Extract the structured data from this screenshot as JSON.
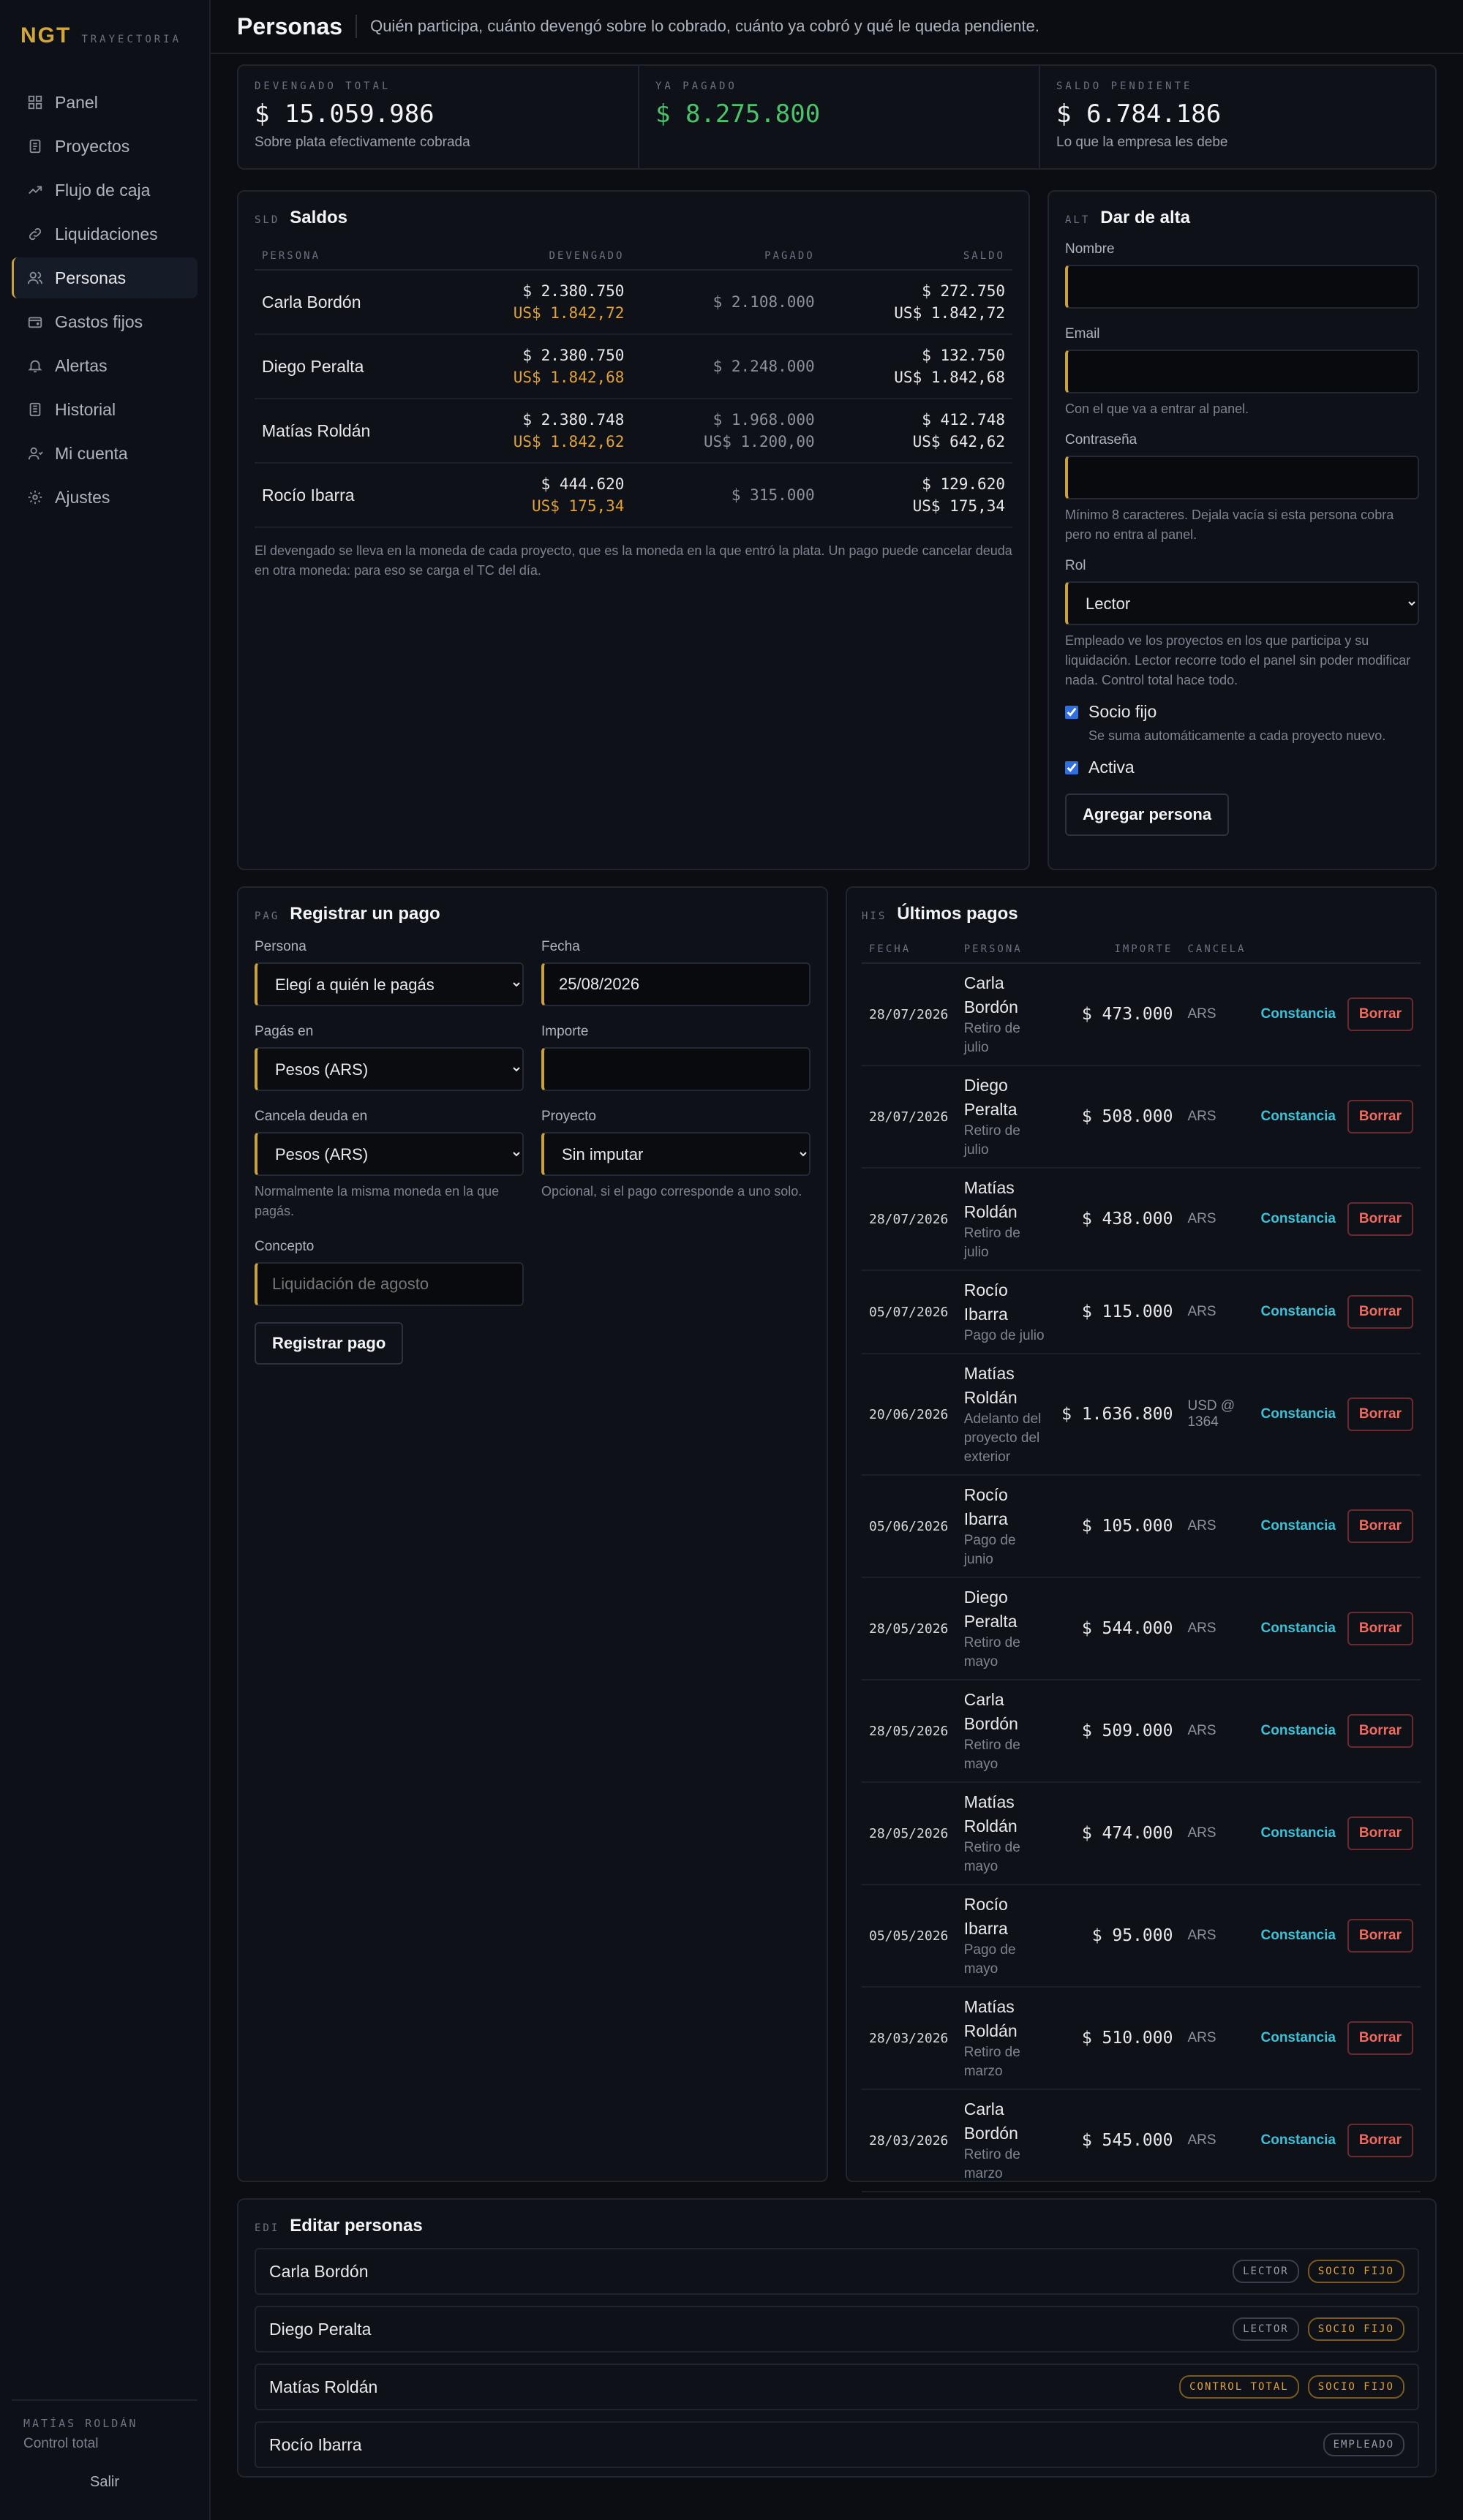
{
  "brand": {
    "logo": "NGT",
    "sub": "TRAYECTORIA"
  },
  "nav": [
    {
      "label": "Panel",
      "icon": "dashboard-icon"
    },
    {
      "label": "Proyectos",
      "icon": "document-icon"
    },
    {
      "label": "Flujo de caja",
      "icon": "trend-icon"
    },
    {
      "label": "Liquidaciones",
      "icon": "link-icon"
    },
    {
      "label": "Personas",
      "icon": "users-icon",
      "active": true
    },
    {
      "label": "Gastos fijos",
      "icon": "wallet-icon"
    },
    {
      "label": "Alertas",
      "icon": "bell-icon"
    },
    {
      "label": "Historial",
      "icon": "history-icon"
    },
    {
      "label": "Mi cuenta",
      "icon": "user-icon"
    },
    {
      "label": "Ajustes",
      "icon": "gear-icon"
    }
  ],
  "user": {
    "name": "MATÍAS ROLDÁN",
    "role": "Control total",
    "logout": "Salir"
  },
  "header": {
    "title": "Personas",
    "subtitle": "Quién participa, cuánto devengó sobre lo cobrado, cuánto ya cobró y qué le queda pendiente."
  },
  "stats": [
    {
      "label": "DEVENGADO TOTAL",
      "value": "$ 15.059.986",
      "note": "Sobre plata efectivamente cobrada"
    },
    {
      "label": "YA PAGADO",
      "value": "$ 8.275.800",
      "note": ""
    },
    {
      "label": "SALDO PENDIENTE",
      "value": "$ 6.784.186",
      "note": "Lo que la empresa les debe"
    }
  ],
  "saldos": {
    "code": "SLD",
    "title": "Saldos",
    "headers": [
      "PERSONA",
      "DEVENGADO",
      "PAGADO",
      "SALDO"
    ],
    "rows": [
      {
        "persona": "Carla Bordón",
        "dev_ars": "$ 2.380.750",
        "dev_usd": "US$ 1.842,72",
        "pag_ars": "$ 2.108.000",
        "pag_usd": "",
        "sal_ars": "$ 272.750",
        "sal_usd": "US$ 1.842,72"
      },
      {
        "persona": "Diego Peralta",
        "dev_ars": "$ 2.380.750",
        "dev_usd": "US$ 1.842,68",
        "pag_ars": "$ 2.248.000",
        "pag_usd": "",
        "sal_ars": "$ 132.750",
        "sal_usd": "US$ 1.842,68"
      },
      {
        "persona": "Matías Roldán",
        "dev_ars": "$ 2.380.748",
        "dev_usd": "US$ 1.842,62",
        "pag_ars": "$ 1.968.000",
        "pag_usd": "US$ 1.200,00",
        "sal_ars": "$ 412.748",
        "sal_usd": "US$ 642,62"
      },
      {
        "persona": "Rocío Ibarra",
        "dev_ars": "$ 444.620",
        "dev_usd": "US$ 175,34",
        "pag_ars": "$ 315.000",
        "pag_usd": "",
        "sal_ars": "$ 129.620",
        "sal_usd": "US$ 175,34"
      }
    ],
    "note": "El devengado se lleva en la moneda de cada proyecto, que es la moneda en la que entró la plata. Un pago puede cancelar deuda en otra moneda: para eso se carga el TC del día."
  },
  "alta": {
    "code": "ALT",
    "title": "Dar de alta",
    "nombre_label": "Nombre",
    "email_label": "Email",
    "email_help": "Con el que va a entrar al panel.",
    "pass_label": "Contraseña",
    "pass_help": "Mínimo 8 caracteres. Dejala vacía si esta persona cobra pero no entra al panel.",
    "rol_label": "Rol",
    "rol_value": "Lector",
    "rol_help": "Empleado ve los proyectos en los que participa y su liquidación. Lector recorre todo el panel sin poder modificar nada. Control total hace todo.",
    "socio_label": "Socio fijo",
    "socio_help": "Se suma automáticamente a cada proyecto nuevo.",
    "activa_label": "Activa",
    "submit": "Agregar persona"
  },
  "pago": {
    "code": "PAG",
    "title": "Registrar un pago",
    "persona_label": "Persona",
    "persona_value": "Elegí a quién le pagás",
    "fecha_label": "Fecha",
    "fecha_value": "25/08/2026",
    "pagas_label": "Pagás en",
    "pagas_value": "Pesos (ARS)",
    "importe_label": "Importe",
    "importe_value": "",
    "cancela_label": "Cancela deuda en",
    "cancela_value": "Pesos (ARS)",
    "cancela_help": "Normalmente la misma moneda en la que pagás.",
    "proyecto_label": "Proyecto",
    "proyecto_value": "Sin imputar",
    "proyecto_help": "Opcional, si el pago corresponde a uno solo.",
    "concepto_label": "Concepto",
    "concepto_placeholder": "Liquidación de agosto",
    "submit": "Registrar pago"
  },
  "historial": {
    "code": "HIS",
    "title": "Últimos pagos",
    "headers": [
      "FECHA",
      "PERSONA",
      "IMPORTE",
      "CANCELA"
    ],
    "constancia": "Constancia",
    "borrar": "Borrar",
    "rows": [
      {
        "fecha": "28/07/2026",
        "persona": [
          "Carla",
          "Bordón"
        ],
        "concepto": [
          "Retiro de",
          "julio"
        ],
        "importe": "$ 473.000",
        "cancela": [
          "ARS"
        ]
      },
      {
        "fecha": "28/07/2026",
        "persona": [
          "Diego",
          "Peralta"
        ],
        "concepto": [
          "Retiro de",
          "julio"
        ],
        "importe": "$ 508.000",
        "cancela": [
          "ARS"
        ]
      },
      {
        "fecha": "28/07/2026",
        "persona": [
          "Matías",
          "Roldán"
        ],
        "concepto": [
          "Retiro de",
          "julio"
        ],
        "importe": "$ 438.000",
        "cancela": [
          "ARS"
        ]
      },
      {
        "fecha": "05/07/2026",
        "persona": [
          "Rocío",
          "Ibarra"
        ],
        "concepto": [
          "Pago de julio"
        ],
        "importe": "$ 115.000",
        "cancela": [
          "ARS"
        ]
      },
      {
        "fecha": "20/06/2026",
        "persona": [
          "Matías",
          "Roldán"
        ],
        "concepto": [
          "Adelanto del",
          "proyecto del",
          "exterior"
        ],
        "importe": "$ 1.636.800",
        "cancela": [
          "USD @",
          "1364"
        ]
      },
      {
        "fecha": "05/06/2026",
        "persona": [
          "Rocío",
          "Ibarra"
        ],
        "concepto": [
          "Pago de",
          "junio"
        ],
        "importe": "$ 105.000",
        "cancela": [
          "ARS"
        ]
      },
      {
        "fecha": "28/05/2026",
        "persona": [
          "Diego",
          "Peralta"
        ],
        "concepto": [
          "Retiro de",
          "mayo"
        ],
        "importe": "$ 544.000",
        "cancela": [
          "ARS"
        ]
      },
      {
        "fecha": "28/05/2026",
        "persona": [
          "Carla",
          "Bordón"
        ],
        "concepto": [
          "Retiro de",
          "mayo"
        ],
        "importe": "$ 509.000",
        "cancela": [
          "ARS"
        ]
      },
      {
        "fecha": "28/05/2026",
        "persona": [
          "Matías",
          "Roldán"
        ],
        "concepto": [
          "Retiro de",
          "mayo"
        ],
        "importe": "$ 474.000",
        "cancela": [
          "ARS"
        ]
      },
      {
        "fecha": "05/05/2026",
        "persona": [
          "Rocío",
          "Ibarra"
        ],
        "concepto": [
          "Pago de",
          "mayo"
        ],
        "importe": "$ 95.000",
        "cancela": [
          "ARS"
        ]
      },
      {
        "fecha": "28/03/2026",
        "persona": [
          "Matías",
          "Roldán"
        ],
        "concepto": [
          "Retiro de",
          "marzo"
        ],
        "importe": "$ 510.000",
        "cancela": [
          "ARS"
        ]
      },
      {
        "fecha": "28/03/2026",
        "persona": [
          "Carla",
          "Bordón"
        ],
        "concepto": [
          "Retiro de",
          "marzo"
        ],
        "importe": "$ 545.000",
        "cancela": [
          "ARS"
        ]
      }
    ]
  },
  "editar": {
    "code": "EDI",
    "title": "Editar personas",
    "rows": [
      {
        "name": "Carla Bordón",
        "badges": [
          {
            "text": "LECTOR",
            "gold": false
          },
          {
            "text": "SOCIO FIJO",
            "gold": true
          }
        ]
      },
      {
        "name": "Diego Peralta",
        "badges": [
          {
            "text": "LECTOR",
            "gold": false
          },
          {
            "text": "SOCIO FIJO",
            "gold": true
          }
        ]
      },
      {
        "name": "Matías Roldán",
        "badges": [
          {
            "text": "CONTROL TOTAL",
            "gold": true
          },
          {
            "text": "SOCIO FIJO",
            "gold": true
          }
        ]
      },
      {
        "name": "Rocío Ibarra",
        "badges": [
          {
            "text": "EMPLEADO",
            "gold": false
          }
        ]
      }
    ]
  }
}
